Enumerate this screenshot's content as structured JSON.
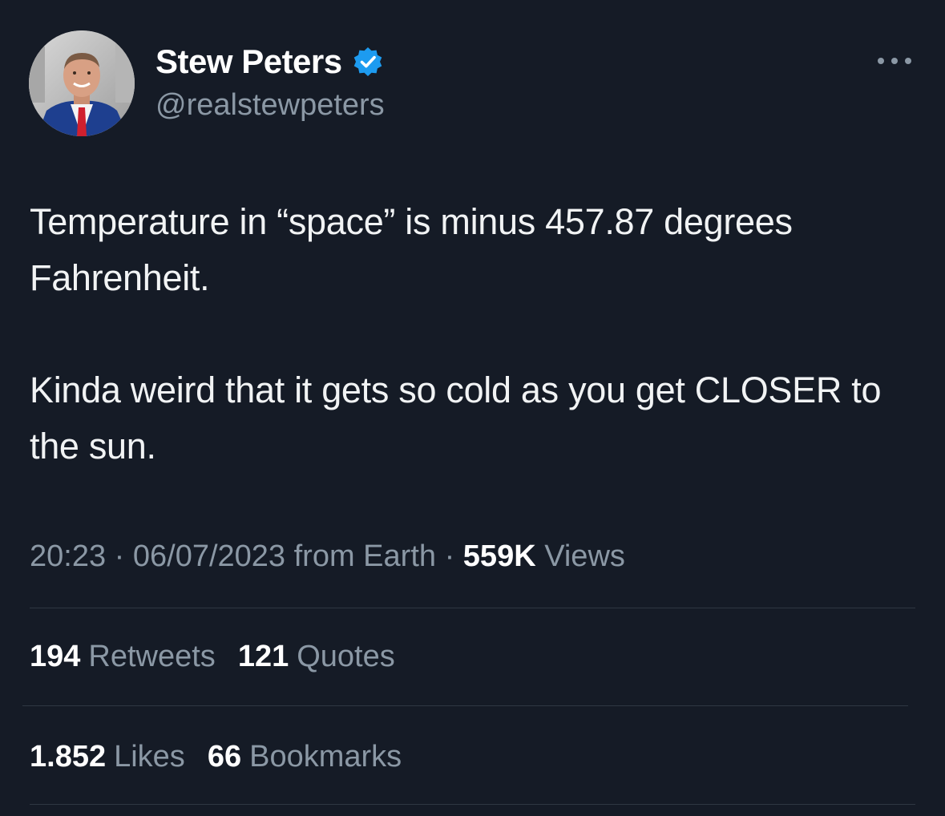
{
  "author": {
    "display_name": "Stew Peters",
    "handle": "@realstewpeters",
    "verified_color": "#1d9bf0"
  },
  "tweet": {
    "paragraphs": [
      "Temperature in “space” is minus 457.87 degrees Fahrenheit.",
      "Kinda weird that it gets so cold as you get CLOSER to the sun."
    ]
  },
  "meta": {
    "time": "20:23",
    "separator": "·",
    "date": "06/07/2023",
    "source": "from Earth",
    "views_count": "559K",
    "views_label": "Views"
  },
  "stats": {
    "retweets": {
      "count": "194",
      "label": "Retweets"
    },
    "quotes": {
      "count": "121",
      "label": "Quotes"
    },
    "likes": {
      "count": "1.852",
      "label": "Likes"
    },
    "bookmarks": {
      "count": "66",
      "label": "Bookmarks"
    }
  },
  "icons": {
    "more": "more-horizontal-icon",
    "verified": "verified-badge-icon"
  },
  "colors": {
    "background": "#151b26",
    "text_primary": "#ffffff",
    "text_secondary": "#8b98a5",
    "divider": "#2f3742"
  }
}
